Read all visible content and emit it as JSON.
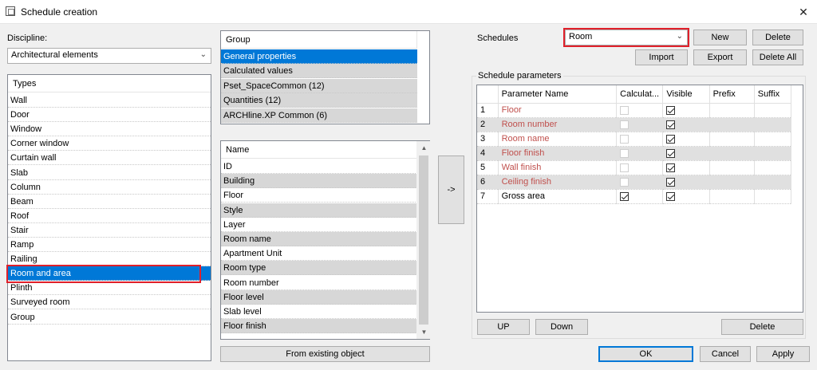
{
  "window": {
    "title": "Schedule creation",
    "close_glyph": "✕"
  },
  "discipline": {
    "label": "Discipline:",
    "value": "Architectural elements"
  },
  "types": {
    "header": "Types",
    "items": [
      "Wall",
      "Door",
      "Window",
      "Corner window",
      "Curtain wall",
      "Slab",
      "Column",
      "Beam",
      "Roof",
      "Stair",
      "Ramp",
      "Railing",
      "Room and area",
      "Plinth",
      "Surveyed room",
      "Group"
    ],
    "selected_index": 12
  },
  "group": {
    "header": "Group",
    "items": [
      "General properties",
      "Calculated values",
      "Pset_SpaceCommon (12)",
      "Quantities (12)",
      "ARCHline.XP Common (6)"
    ],
    "selected_index": 0
  },
  "names": {
    "header": "Name",
    "items": [
      "ID",
      "Building",
      "Floor",
      "Style",
      "Layer",
      "Room name",
      "Apartment Unit",
      "Room type",
      "Room number",
      "Floor level",
      "Slab level",
      "Floor finish"
    ]
  },
  "from_existing_label": "From existing object",
  "transfer_label": "->",
  "schedules": {
    "label": "Schedules",
    "value": "Room",
    "buttons": {
      "new": "New",
      "delete": "Delete",
      "import": "Import",
      "export": "Export",
      "delete_all": "Delete All"
    }
  },
  "params": {
    "group_label": "Schedule parameters",
    "columns": [
      "",
      "Parameter Name",
      "Calculat...",
      "Visible",
      "Prefix",
      "Suffix"
    ],
    "rows": [
      {
        "num": "1",
        "name": "Floor",
        "calc": false,
        "visible": true
      },
      {
        "num": "2",
        "name": "Room number",
        "calc": false,
        "visible": true
      },
      {
        "num": "3",
        "name": "Room name",
        "calc": false,
        "visible": true
      },
      {
        "num": "4",
        "name": "Floor finish",
        "calc": false,
        "visible": true
      },
      {
        "num": "5",
        "name": "Wall finish",
        "calc": false,
        "visible": true
      },
      {
        "num": "6",
        "name": "Ceiling finish",
        "calc": false,
        "visible": true
      },
      {
        "num": "7",
        "name": "Gross area",
        "calc": true,
        "visible": true
      }
    ],
    "up": "UP",
    "down": "Down",
    "delete": "Delete"
  },
  "footer": {
    "ok": "OK",
    "cancel": "Cancel",
    "apply": "Apply"
  }
}
